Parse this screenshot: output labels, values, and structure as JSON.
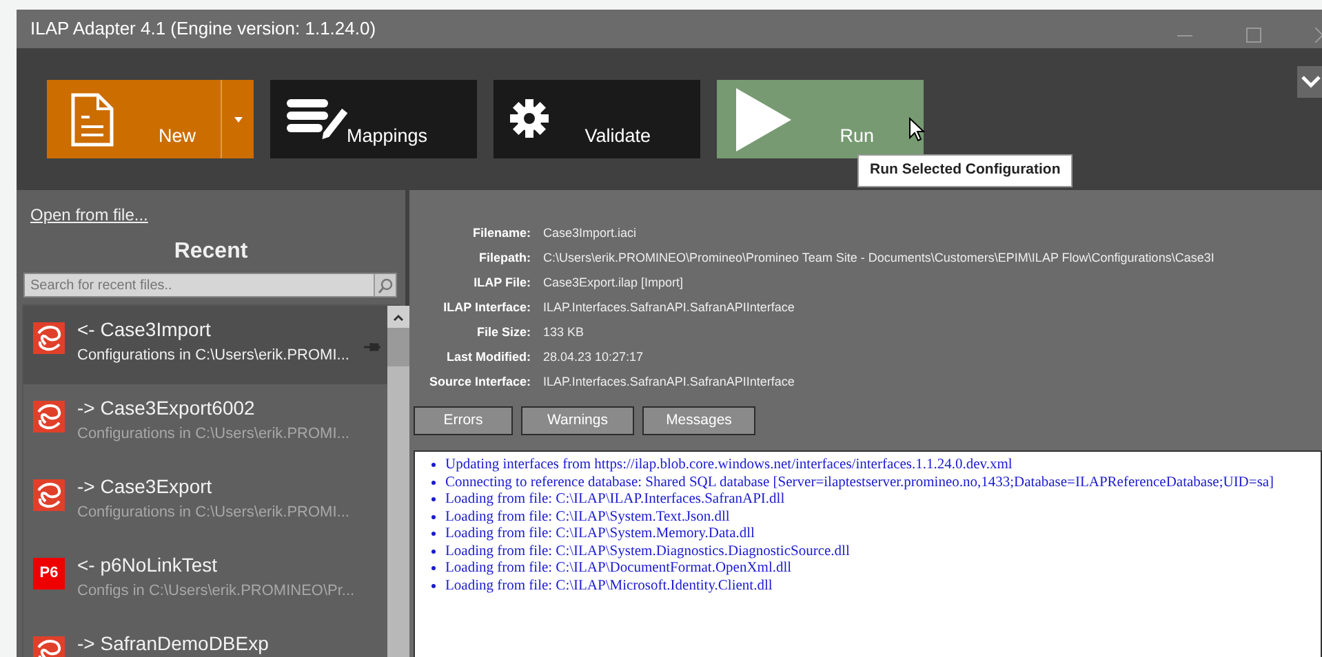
{
  "window": {
    "title": "ILAP Adapter 4.1 (Engine version: 1.1.24.0)"
  },
  "toolbar": {
    "buttons": [
      {
        "kind": "new",
        "label": "New",
        "color": "#cc6d00"
      },
      {
        "kind": "mappings",
        "label": "Mappings",
        "color": "#1a1a1a"
      },
      {
        "kind": "validate",
        "label": "Validate",
        "color": "#1a1a1a"
      },
      {
        "kind": "run",
        "label": "Run",
        "color": "#779a72"
      }
    ],
    "tooltip": "Run Selected Configuration"
  },
  "sidebar": {
    "open_link": "Open from file...",
    "heading": "Recent",
    "search": {
      "placeholder": "Search for recent files.."
    },
    "items": [
      {
        "kind": "safran",
        "title": "<- Case3Import",
        "subtitle": "Configurations in C:\\Users\\erik.PROMI...",
        "selected": true,
        "pinned": true
      },
      {
        "kind": "safran",
        "title": "-> Case3Export6002",
        "subtitle": "Configurations in C:\\Users\\erik.PROMI...",
        "selected": false,
        "pinned": false
      },
      {
        "kind": "safran",
        "title": "-> Case3Export",
        "subtitle": "Configurations in C:\\Users\\erik.PROMI...",
        "selected": false,
        "pinned": false
      },
      {
        "kind": "p6",
        "badge": "P6",
        "title": "<- p6NoLinkTest",
        "subtitle": "Configs in C:\\Users\\erik.PROMINEO\\Pr...",
        "selected": false,
        "pinned": false
      },
      {
        "kind": "safran",
        "title": "-> SafranDemoDBExp",
        "selected": false,
        "pinned": false
      }
    ]
  },
  "details": [
    {
      "label": "Filename:",
      "value": "Case3Import.iaci"
    },
    {
      "label": "Filepath:",
      "value": "C:\\Users\\erik.PROMINEO\\Promineo\\Promineo Team Site - Documents\\Customers\\EPIM\\ILAP Flow\\Configurations\\Case3I"
    },
    {
      "label": "ILAP File:",
      "value": "Case3Export.ilap [Import]"
    },
    {
      "label": "ILAP Interface:",
      "value": "ILAP.Interfaces.SafranAPI.SafranAPIInterface"
    },
    {
      "label": "File Size:",
      "value": "133 KB"
    },
    {
      "label": "Last Modified:",
      "value": "28.04.23 10:27:17"
    },
    {
      "label": "Source Interface:",
      "value": "ILAP.Interfaces.SafranAPI.SafranAPIInterface"
    }
  ],
  "log_tabs": [
    "Errors",
    "Warnings",
    "Messages"
  ],
  "log": [
    "Updating interfaces from https://ilap.blob.core.windows.net/interfaces/interfaces.1.1.24.0.dev.xml",
    "Connecting to reference database: Shared SQL database [Server=ilaptestserver.promineo.no,1433;Database=ILAPReferenceDatabase;UID=sa]",
    "Loading from file: C:\\ILAP\\ILAP.Interfaces.SafranAPI.dll",
    "Loading from file: C:\\ILAP\\System.Text.Json.dll",
    "Loading from file: C:\\ILAP\\System.Memory.Data.dll",
    "Loading from file: C:\\ILAP\\System.Diagnostics.DiagnosticSource.dll",
    "Loading from file: C:\\ILAP\\DocumentFormat.OpenXml.dll",
    "Loading from file: C:\\ILAP\\Microsoft.Identity.Client.dll"
  ]
}
